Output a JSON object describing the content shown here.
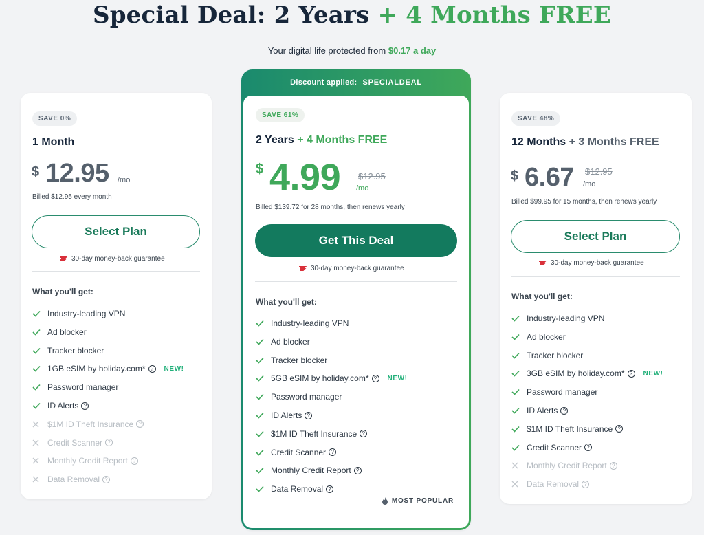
{
  "header": {
    "title_main": "Special Deal: 2 Years",
    "title_free": "+ 4 Months FREE",
    "subtitle_prefix": "Your digital life protected from",
    "subtitle_price": "$0.17 a day"
  },
  "guarantee_text": "30-day money-back guarantee",
  "what_label": "What you'll get:",
  "plans": {
    "monthly": {
      "badge": "SAVE 0%",
      "name": "1 Month",
      "currency": "$",
      "price": "12.95",
      "per": "/mo",
      "billed": "Billed $12.95 every month",
      "cta": "Select Plan",
      "features": [
        {
          "label": "Industry-leading VPN",
          "included": true
        },
        {
          "label": "Ad blocker",
          "included": true
        },
        {
          "label": "Tracker blocker",
          "included": true
        },
        {
          "label": "1GB eSIM by holiday.com*",
          "included": true,
          "new": "NEW!"
        },
        {
          "label": "Password manager",
          "included": true
        },
        {
          "label": "ID Alerts",
          "included": true
        },
        {
          "label": "$1M ID Theft Insurance",
          "included": false
        },
        {
          "label": "Credit Scanner",
          "included": false
        },
        {
          "label": "Monthly Credit Report",
          "included": false
        },
        {
          "label": "Data Removal",
          "included": false
        }
      ]
    },
    "two_year": {
      "discount_label": "Discount applied:",
      "discount_code": "SPECIALDEAL",
      "badge": "SAVE 61%",
      "name_main": "2 Years",
      "name_free": "+ 4 Months FREE",
      "currency": "$",
      "price": "4.99",
      "old_price": "$12.95",
      "per": "/mo",
      "billed": "Billed $139.72 for 28 months, then renews yearly",
      "cta": "Get This Deal",
      "most_popular": "MOST POPULAR",
      "features": [
        {
          "label": "Industry-leading VPN",
          "included": true
        },
        {
          "label": "Ad blocker",
          "included": true
        },
        {
          "label": "Tracker blocker",
          "included": true
        },
        {
          "label": "5GB eSIM by holiday.com*",
          "included": true,
          "new": "NEW!"
        },
        {
          "label": "Password manager",
          "included": true
        },
        {
          "label": "ID Alerts",
          "included": true
        },
        {
          "label": "$1M ID Theft Insurance",
          "included": true
        },
        {
          "label": "Credit Scanner",
          "included": true
        },
        {
          "label": "Monthly Credit Report",
          "included": true
        },
        {
          "label": "Data Removal",
          "included": true
        }
      ]
    },
    "yearly": {
      "badge": "SAVE 48%",
      "name_main": "12 Months",
      "name_free": "+ 3 Months FREE",
      "currency": "$",
      "price": "6.67",
      "old_price": "$12.95",
      "per": "/mo",
      "billed": "Billed $99.95 for 15 months, then renews yearly",
      "cta": "Select Plan",
      "features": [
        {
          "label": "Industry-leading VPN",
          "included": true
        },
        {
          "label": "Ad blocker",
          "included": true
        },
        {
          "label": "Tracker blocker",
          "included": true
        },
        {
          "label": "3GB eSIM by holiday.com*",
          "included": true,
          "new": "NEW!"
        },
        {
          "label": "Password manager",
          "included": true
        },
        {
          "label": "ID Alerts",
          "included": true
        },
        {
          "label": "$1M ID Theft Insurance",
          "included": true
        },
        {
          "label": "Credit Scanner",
          "included": true
        },
        {
          "label": "Monthly Credit Report",
          "included": false
        },
        {
          "label": "Data Removal",
          "included": false
        }
      ]
    }
  },
  "colors": {
    "brand_green": "#3fa85a",
    "cta_green": "#137a5e",
    "outline_green": "#2a8c6e",
    "new_badge": "#22b07a"
  }
}
